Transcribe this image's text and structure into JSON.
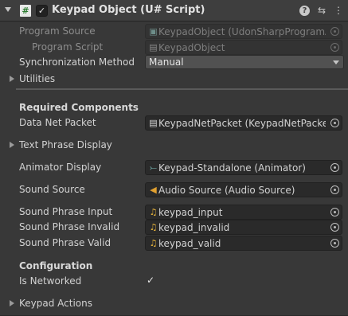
{
  "header": {
    "title": "Keypad Object (U# Script)",
    "script_icon_glyph": "#",
    "enabled_glyph": "✓",
    "help_glyph": "?",
    "presets_glyph": "⇆",
    "menu_glyph": "⋮"
  },
  "rows": {
    "program_source": {
      "label": "Program Source",
      "value": "KeypadObject (UdonSharpProgramAsset)",
      "icon": "asset-icon"
    },
    "program_script": {
      "label": "Program Script",
      "value": "KeypadObject",
      "icon": "script-file-icon"
    },
    "sync_method": {
      "label": "Synchronization Method",
      "value": "Manual"
    },
    "utilities": {
      "label": "Utilities"
    },
    "required_components": {
      "label": "Required Components"
    },
    "data_net_packet": {
      "label": "Data Net Packet",
      "value": "KeypadNetPacket (KeypadNetPacket)",
      "icon": "script-file-icon"
    },
    "text_phrase_display": {
      "label": "Text Phrase Display"
    },
    "animator_display": {
      "label": "Animator Display",
      "value": "Keypad-Standalone (Animator)",
      "icon": "animator-icon"
    },
    "sound_source": {
      "label": "Sound Source",
      "value": "Audio Source (Audio Source)",
      "icon": "audio-source-icon"
    },
    "sound_phrase_input": {
      "label": "Sound Phrase Input",
      "value": "keypad_input",
      "icon": "audio-clip-icon"
    },
    "sound_phrase_invalid": {
      "label": "Sound Phrase Invalid",
      "value": "keypad_invalid",
      "icon": "audio-clip-icon"
    },
    "sound_phrase_valid": {
      "label": "Sound Phrase Valid",
      "value": "keypad_valid",
      "icon": "audio-clip-icon"
    },
    "configuration": {
      "label": "Configuration"
    },
    "is_networked": {
      "label": "Is Networked",
      "checked": true
    },
    "keypad_actions": {
      "label": "Keypad Actions"
    }
  },
  "colors": {
    "background": "#383838",
    "field_bg": "#2a2a2a",
    "audio_clip_icon": "#e8b43a",
    "audio_source_icon": "#e0a030",
    "animator_icon": "#7fc4c0"
  }
}
